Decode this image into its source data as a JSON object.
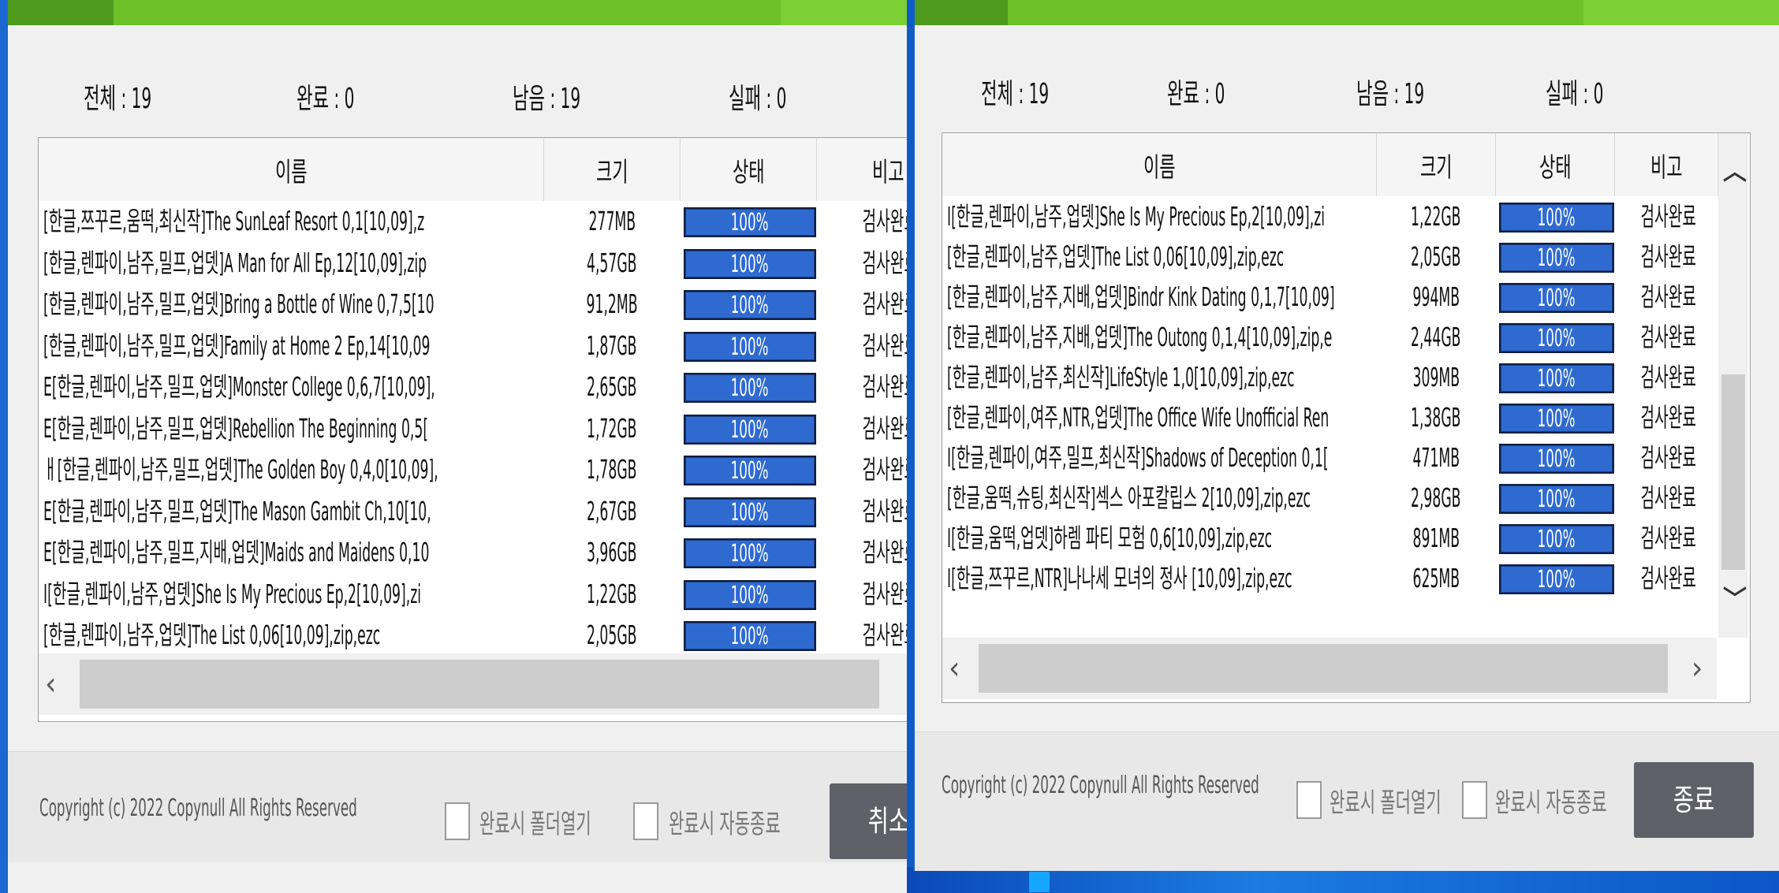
{
  "colors": {
    "accent": "#6ec12a",
    "progress": "#2f6ad1",
    "button": "#5f6168"
  },
  "left": {
    "stats": {
      "total": "전체 : 19",
      "done": "완료 : 0",
      "remaining": "남음 : 19",
      "failed": "실패 : 0"
    },
    "columns": {
      "name": "이름",
      "size": "크기",
      "status": "상태",
      "note": "비고"
    },
    "rows": [
      {
        "name": "[한글,쯔꾸르,움떡,최신작]The SunLeaf Resort 0,1[10,09],z",
        "size": "277MB",
        "progress": "100%",
        "note": "검사완료"
      },
      {
        "name": "[한글,렌파이,남주,밀프,업뎃]A Man for All Ep,12[10,09],zip",
        "size": "4,57GB",
        "progress": "100%",
        "note": "검사완료"
      },
      {
        "name": "[한글,렌파이,남주,밀프,업뎃]Bring a Bottle of Wine 0,7,5[10",
        "size": "91,2MB",
        "progress": "100%",
        "note": "검사완료"
      },
      {
        "name": "[한글,렌파이,남주,밀프,업뎃]Family at Home 2 Ep,14[10,09",
        "size": "1,87GB",
        "progress": "100%",
        "note": "검사완료"
      },
      {
        "name": "E[한글,렌파이,남주,밀프,업뎃]Monster College 0,6,7[10,09],",
        "size": "2,65GB",
        "progress": "100%",
        "note": "검사완료"
      },
      {
        "name": "E[한글,렌파이,남주,밀프,업뎃]Rebellion The Beginning 0,5[",
        "size": "1,72GB",
        "progress": "100%",
        "note": "검사완료"
      },
      {
        "name": "ㅐ[한글,렌파이,남주,밀프,업뎃]The Golden Boy 0,4,0[10,09],",
        "size": "1,78GB",
        "progress": "100%",
        "note": "검사완료"
      },
      {
        "name": "E[한글,렌파이,남주,밀프,업뎃]The Mason Gambit Ch,10[10,",
        "size": "2,67GB",
        "progress": "100%",
        "note": "검사완료"
      },
      {
        "name": "E[한글,렌파이,남주,밀프,지배,업뎃]Maids and Maidens 0,10",
        "size": "3,96GB",
        "progress": "100%",
        "note": "검사완료"
      },
      {
        "name": "I[한글,렌파이,남주,업뎃]She Is My Precious Ep,2[10,09],zi",
        "size": "1,22GB",
        "progress": "100%",
        "note": "검사완료"
      },
      {
        "name": "[한글,렌파이,남주,업뎃]The List 0,06[10,09],zip,ezc",
        "size": "2,05GB",
        "progress": "100%",
        "note": "검사완료"
      }
    ],
    "footer": {
      "copyright": "Copyright (c) 2022 Copynull All Rights Reserved",
      "open_folder": "완료시 폴더열기",
      "auto_close": "완료시 자동종료",
      "button": "취소"
    }
  },
  "right": {
    "stats": {
      "total": "전체 : 19",
      "done": "완료 : 0",
      "remaining": "남음 : 19",
      "failed": "실패 : 0"
    },
    "columns": {
      "name": "이름",
      "size": "크기",
      "status": "상태",
      "note": "비고"
    },
    "rows": [
      {
        "name": "I[한글,렌파이,남주,업뎃]She Is My Precious Ep,2[10,09],zi",
        "size": "1,22GB",
        "progress": "100%",
        "note": "검사완료"
      },
      {
        "name": "[한글,렌파이,남주,업뎃]The List 0,06[10,09],zip,ezc",
        "size": "2,05GB",
        "progress": "100%",
        "note": "검사완료"
      },
      {
        "name": "[한글,렌파이,남주,지배,업뎃]Bindr Kink Dating 0,1,7[10,09]",
        "size": "994MB",
        "progress": "100%",
        "note": "검사완료"
      },
      {
        "name": "[한글,렌파이,남주,지배,업뎃]The Outong 0,1,4[10,09],zip,e",
        "size": "2,44GB",
        "progress": "100%",
        "note": "검사완료"
      },
      {
        "name": "[한글,렌파이,남주,최신작]LifeStyle 1,0[10,09],zip,ezc",
        "size": "309MB",
        "progress": "100%",
        "note": "검사완료"
      },
      {
        "name": "[한글,렌파이,여주,NTR,업뎃]The Office Wife Unofficial Ren",
        "size": "1,38GB",
        "progress": "100%",
        "note": "검사완료"
      },
      {
        "name": "I[한글,렌파이,여주,밀프,최신작]Shadows of Deception 0,1[",
        "size": "471MB",
        "progress": "100%",
        "note": "검사완료"
      },
      {
        "name": "[한글,움떡,슈팅,최신작]섹스 아포칼립스 2[10,09],zip,ezc",
        "size": "2,98GB",
        "progress": "100%",
        "note": "검사완료"
      },
      {
        "name": "I[한글,움떡,업뎃]하렘 파티 모험 0,6[10,09],zip,ezc",
        "size": "891MB",
        "progress": "100%",
        "note": "검사완료"
      },
      {
        "name": "I[한글,쯔꾸르,NTR]나나세 모녀의 정사 [10,09],zip,ezc",
        "size": "625MB",
        "progress": "100%",
        "note": "검사완료"
      }
    ],
    "footer": {
      "copyright": "Copyright (c) 2022 Copynull All Rights Reserved",
      "open_folder": "완료시 폴더열기",
      "auto_close": "완료시 자동종료",
      "button": "종료"
    }
  }
}
